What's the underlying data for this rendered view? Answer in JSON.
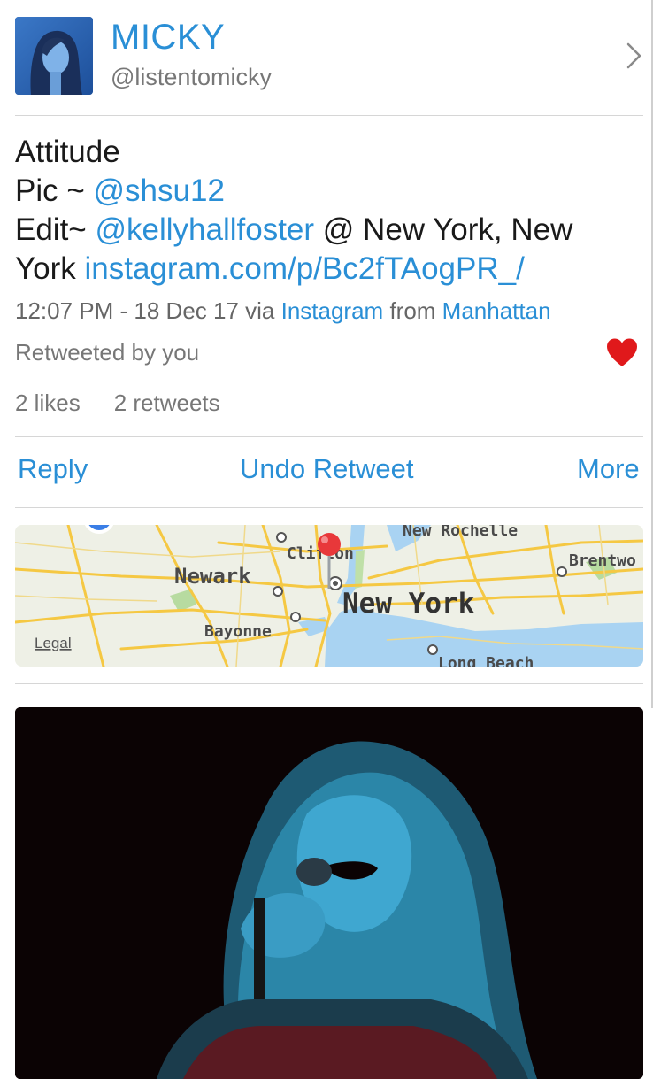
{
  "user": {
    "display_name": "MICKY",
    "handle": "@listentomicky"
  },
  "tweet": {
    "line1": "Attitude",
    "line2_prefix": "Pic ~ ",
    "line2_mention": "@shsu12",
    "line3_prefix": "Edit~ ",
    "line3_mention": "@kellyhallfoster",
    "line3_suffix": " @ New York, New",
    "line4_prefix": "York ",
    "line4_link": "instagram.com/p/Bc2fTAogPR_/"
  },
  "meta": {
    "timestamp": "12:07 PM - 18 Dec 17",
    "via_label": " via ",
    "via_app": "Instagram",
    "from_label": " from ",
    "place": "Manhattan"
  },
  "retweeted_by": "Retweeted by you",
  "stats": {
    "likes": "2 likes",
    "retweets": "2 retweets"
  },
  "actions": {
    "reply": "Reply",
    "undo_retweet": "Undo Retweet",
    "more": "More"
  },
  "map": {
    "labels": {
      "new_rochelle": "New Rochelle",
      "clifton": "Clifton",
      "newark": "Newark",
      "new_york": "New York",
      "bayonne": "Bayonne",
      "brentwood": "Brentwo",
      "long_beach": "Long Beach",
      "legal": "Legal"
    }
  },
  "colors": {
    "link": "#2a8fd6",
    "heart": "#e0191b",
    "map_road": "#f5c843",
    "map_water": "#a9d3f2"
  },
  "icons": {
    "disclosure": "chevron-right-icon",
    "like": "heart-icon",
    "pin": "map-pin-icon"
  }
}
